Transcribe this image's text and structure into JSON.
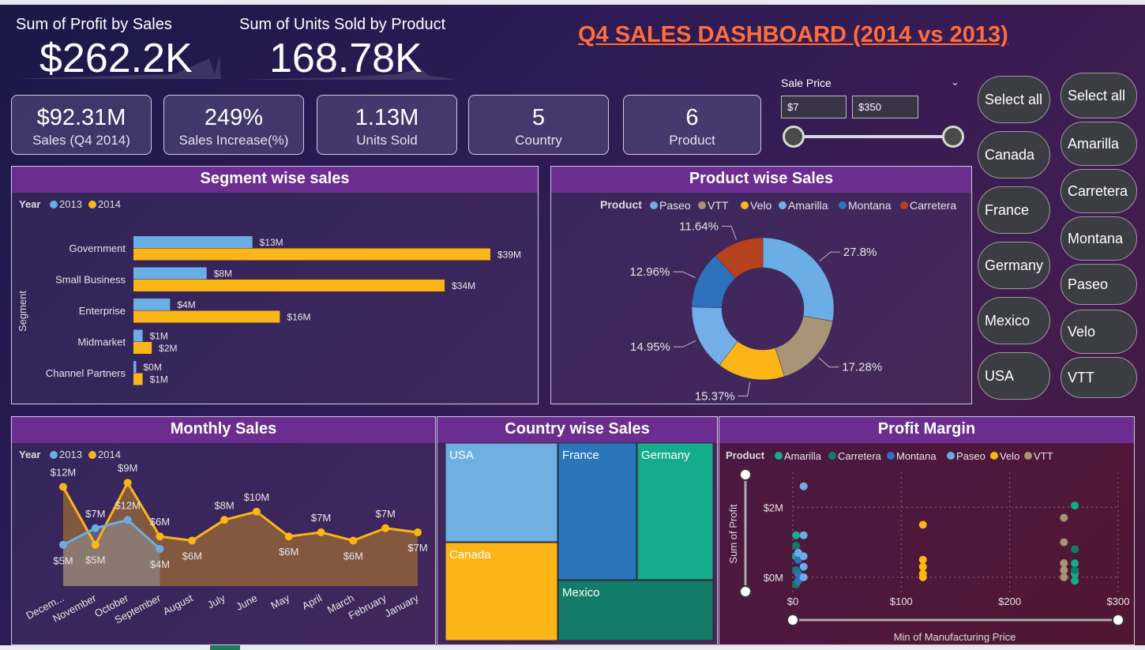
{
  "kpi_profit": {
    "label": "Sum of Profit by Sales",
    "value": "$262.2K"
  },
  "kpi_units_product": {
    "label": "Sum of Units Sold by Product",
    "value": "168.78K"
  },
  "dashboard_title": "Q4 SALES DASHBOARD (2014 vs 2013)",
  "cards": [
    {
      "value": "$92.31M",
      "label": "Sales (Q4 2014)"
    },
    {
      "value": "249%",
      "label": "Sales Increase(%)"
    },
    {
      "value": "1.13M",
      "label": "Units Sold"
    },
    {
      "value": "5",
      "label": "Country"
    },
    {
      "value": "6",
      "label": "Product"
    }
  ],
  "sale_price": {
    "title": "Sale Price",
    "min": "$7",
    "max": "$350"
  },
  "country_slicer": [
    "Select all",
    "Canada",
    "France",
    "Germany",
    "Mexico",
    "USA"
  ],
  "product_slicer": [
    "Select all",
    "Amarilla",
    "Carretera",
    "Montana",
    "Paseo",
    "Velo",
    "VTT"
  ],
  "colors": {
    "y2013": "#6aaee5",
    "y2014": "#fbb516",
    "header": "#6b2d90",
    "title": "#ff6d3a"
  },
  "segment_panel": {
    "title": "Segment wise sales",
    "legend_title": "Year",
    "legend": [
      "2013",
      "2014"
    ],
    "axis_label": "Segment"
  },
  "product_panel": {
    "title": "Product wise Sales",
    "legend_title": "Product"
  },
  "monthly_panel": {
    "title": "Monthly Sales",
    "legend_title": "Year",
    "legend": [
      "2013",
      "2014"
    ]
  },
  "country_panel": {
    "title": "Country wise Sales"
  },
  "profit_panel": {
    "title": "Profit Margin",
    "legend_title": "Product",
    "xlabel": "Min of Manufacturing Price",
    "ylabel": "Sum of Profit"
  },
  "chart_data": [
    {
      "id": "segment",
      "type": "bar",
      "categories": [
        "Government",
        "Small Business",
        "Enterprise",
        "Midmarket",
        "Channel Partners"
      ],
      "series": [
        {
          "name": "2013",
          "values": [
            13,
            8,
            4,
            1,
            0.3
          ],
          "labels": [
            "$13M",
            "$8M",
            "$4M",
            "$1M",
            "$0M"
          ]
        },
        {
          "name": "2014",
          "values": [
            39,
            34,
            16,
            2,
            1
          ],
          "labels": [
            "$39M",
            "$34M",
            "$16M",
            "$2M",
            "$1M"
          ]
        }
      ],
      "ylabel": "Segment"
    },
    {
      "id": "product",
      "type": "pie",
      "slices": [
        {
          "name": "Paseo",
          "value": 27.8,
          "label": "27.8%",
          "color": "#6aaee5"
        },
        {
          "name": "VTT",
          "value": 17.28,
          "label": "17.28%",
          "color": "#a99376"
        },
        {
          "name": "Velo",
          "value": 15.37,
          "label": "15.37%",
          "color": "#fbb516"
        },
        {
          "name": "Amarilla",
          "value": 14.95,
          "label": "14.95%",
          "color": "#74aee8"
        },
        {
          "name": "Montana",
          "value": 12.96,
          "label": "12.96%",
          "color": "#2d72bd"
        },
        {
          "name": "Carretera",
          "value": 11.64,
          "label": "11.64%",
          "color": "#b6411d"
        }
      ]
    },
    {
      "id": "monthly",
      "type": "area",
      "categories": [
        "December",
        "November",
        "October",
        "September",
        "August",
        "July",
        "June",
        "May",
        "April",
        "March",
        "February",
        "January"
      ],
      "category_labels": [
        "Decem...",
        "November",
        "October",
        "September",
        "August",
        "July",
        "June",
        "May",
        "April",
        "March",
        "February",
        "January"
      ],
      "series": [
        {
          "name": "2013",
          "values": [
            5,
            7,
            8,
            4.5,
            null,
            null,
            null,
            null,
            null,
            null,
            null,
            null
          ],
          "labels": [
            "$5M",
            "$7M",
            "$12M",
            "$4M",
            "",
            "",
            "",
            "",
            "",
            "",
            "",
            ""
          ]
        },
        {
          "name": "2014",
          "values": [
            12,
            5,
            12.5,
            6,
            5.5,
            8,
            9,
            6,
            6.5,
            5.5,
            7,
            6.5
          ],
          "labels": [
            "$12M",
            "$5M",
            "$9M",
            "$6M",
            "$6M",
            "$8M",
            "$10M",
            "$6M",
            "$7M",
            "$6M",
            "$7M",
            "$7M"
          ]
        }
      ]
    },
    {
      "id": "country",
      "type": "table",
      "cells": [
        {
          "name": "USA",
          "color": "#6eb0e2"
        },
        {
          "name": "France",
          "color": "#2b76bb"
        },
        {
          "name": "Germany",
          "color": "#14ac8a"
        },
        {
          "name": "Canada",
          "color": "#fbb516"
        },
        {
          "name": "Mexico",
          "color": "#137c68"
        }
      ]
    },
    {
      "id": "profit",
      "type": "scatter",
      "xlabel": "Min of Manufacturing Price",
      "ylabel": "Sum of Profit",
      "xticks": [
        "$0",
        "$100",
        "$200",
        "$300"
      ],
      "yticks": [
        "$0M",
        "$2M"
      ],
      "xlim": [
        0,
        300
      ],
      "ylim": [
        -0.5,
        3
      ],
      "series": [
        {
          "name": "Amarilla",
          "color": "#14ac8a",
          "points": [
            [
              3,
              1.2
            ],
            [
              3,
              0.6
            ],
            [
              260,
              2.05
            ],
            [
              260,
              0.4
            ],
            [
              260,
              0.1
            ],
            [
              260,
              -0.1
            ]
          ]
        },
        {
          "name": "Carretera",
          "color": "#137c68",
          "points": [
            [
              3,
              0.9
            ],
            [
              3,
              0.2
            ],
            [
              3,
              -0.2
            ],
            [
              260,
              0.8
            ],
            [
              260,
              0.2
            ]
          ]
        },
        {
          "name": "Montana",
          "color": "#2d72bd",
          "points": [
            [
              5,
              0.5
            ],
            [
              5,
              0.1
            ],
            [
              10,
              0.3
            ],
            [
              5,
              -0.1
            ]
          ]
        },
        {
          "name": "Paseo",
          "color": "#6aaee5",
          "points": [
            [
              10,
              2.6
            ],
            [
              10,
              1.2
            ],
            [
              10,
              0.6
            ],
            [
              10,
              0.3
            ],
            [
              10,
              0.0
            ],
            [
              5,
              0.7
            ]
          ]
        },
        {
          "name": "Velo",
          "color": "#fbb516",
          "points": [
            [
              120,
              1.5
            ],
            [
              120,
              0.5
            ],
            [
              120,
              0.3
            ],
            [
              120,
              0.1
            ],
            [
              120,
              0.0
            ]
          ]
        },
        {
          "name": "VTT",
          "color": "#a99376",
          "points": [
            [
              250,
              1.7
            ],
            [
              250,
              1.0
            ],
            [
              250,
              0.4
            ],
            [
              250,
              0.2
            ],
            [
              250,
              0.0
            ]
          ]
        }
      ]
    }
  ]
}
